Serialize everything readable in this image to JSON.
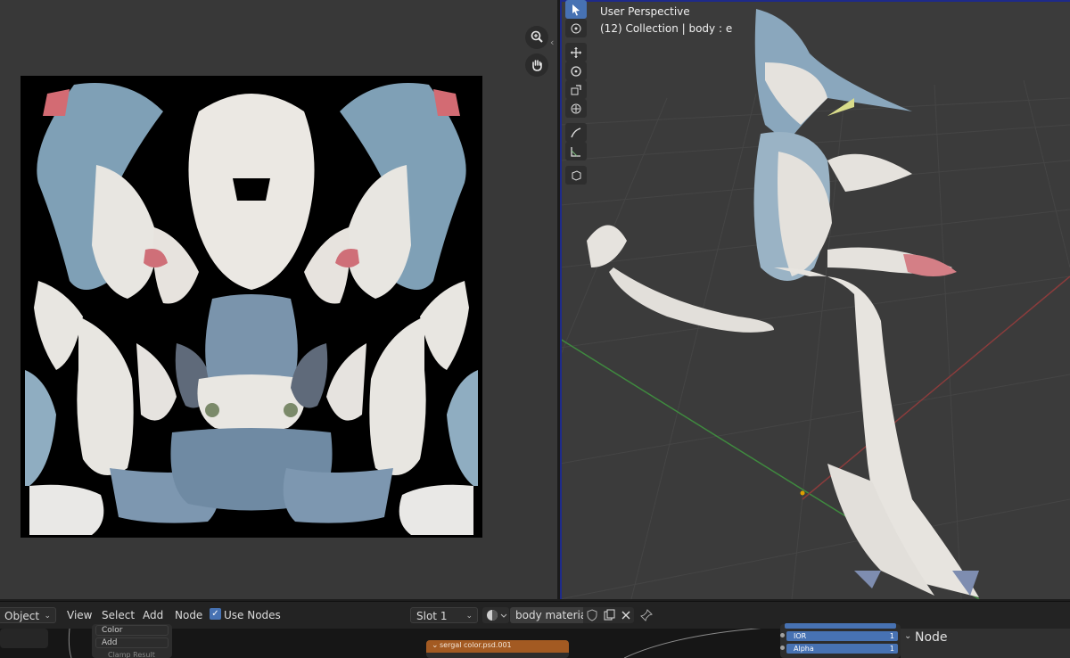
{
  "viewport": {
    "title": "User Perspective",
    "subtitle": "(12) Collection | body : e"
  },
  "header": {
    "mode_label": "Object",
    "menu": [
      "View",
      "Select",
      "Add",
      "Node"
    ],
    "use_nodes_label": "Use Nodes",
    "use_nodes_checked": true,
    "slot_label": "Slot 1",
    "material_name": "body material"
  },
  "node_editor": {
    "left_node_field1": "Color",
    "left_node_field2": "Add",
    "left_node_field3": "Clamp Result",
    "image_node_title": "sergal color.psd.001",
    "right_fields": [
      "IOR",
      "Alpha"
    ],
    "right_values": [
      "1",
      "1"
    ],
    "sidebar_title": "Node"
  },
  "colors": {
    "accent": "#4772b3",
    "active_outline": "#1e2a8a",
    "image_node_header": "#a35a22"
  }
}
